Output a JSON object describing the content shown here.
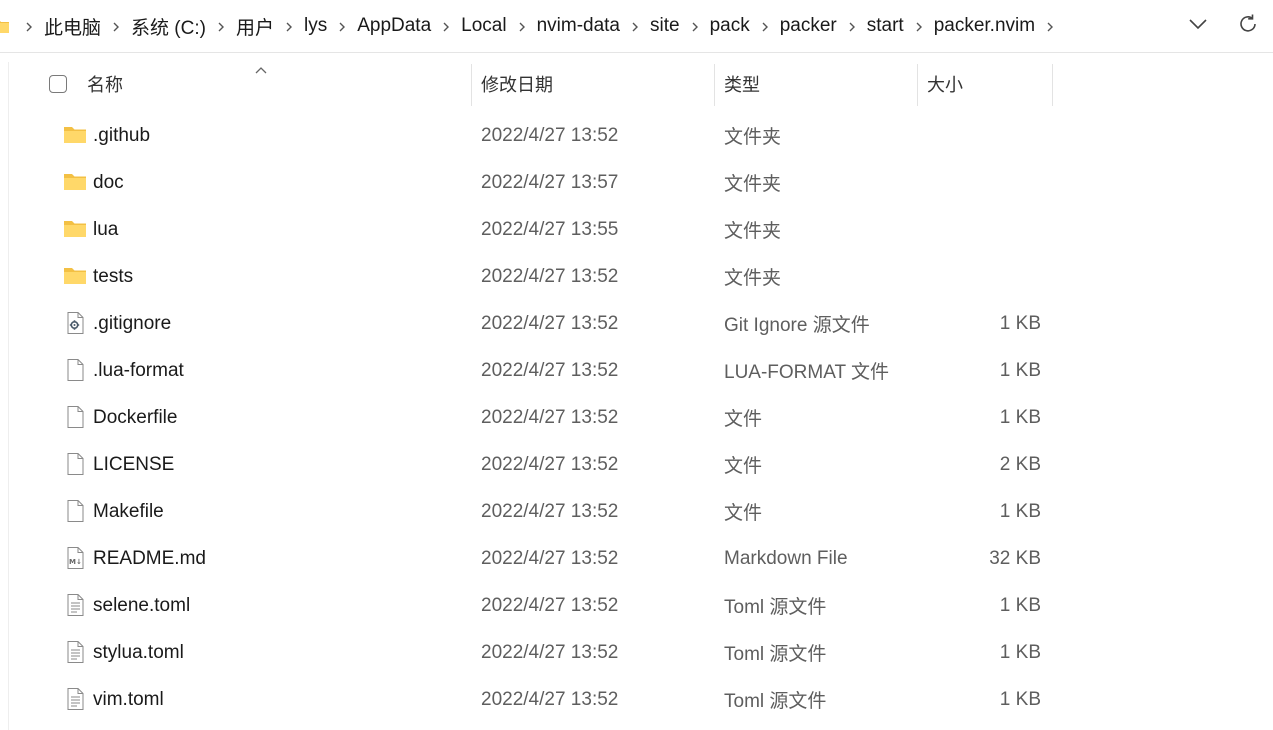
{
  "breadcrumb": {
    "items": [
      "此电脑",
      "系统 (C:)",
      "用户",
      "lys",
      "AppData",
      "Local",
      "nvim-data",
      "site",
      "pack",
      "packer",
      "start",
      "packer.nvim"
    ]
  },
  "columns": {
    "name": "名称",
    "date": "修改日期",
    "type": "类型",
    "size": "大小"
  },
  "files": [
    {
      "name": ".github",
      "date": "2022/4/27 13:52",
      "type": "文件夹",
      "size": "",
      "icon": "folder-icon"
    },
    {
      "name": "doc",
      "date": "2022/4/27 13:57",
      "type": "文件夹",
      "size": "",
      "icon": "folder-icon"
    },
    {
      "name": "lua",
      "date": "2022/4/27 13:55",
      "type": "文件夹",
      "size": "",
      "icon": "folder-icon"
    },
    {
      "name": "tests",
      "date": "2022/4/27 13:52",
      "type": "文件夹",
      "size": "",
      "icon": "folder-icon"
    },
    {
      "name": ".gitignore",
      "date": "2022/4/27 13:52",
      "type": "Git Ignore 源文件",
      "size": "1 KB",
      "icon": "settings-file-icon"
    },
    {
      "name": ".lua-format",
      "date": "2022/4/27 13:52",
      "type": "LUA-FORMAT 文件",
      "size": "1 KB",
      "icon": "file-icon"
    },
    {
      "name": "Dockerfile",
      "date": "2022/4/27 13:52",
      "type": "文件",
      "size": "1 KB",
      "icon": "file-icon"
    },
    {
      "name": "LICENSE",
      "date": "2022/4/27 13:52",
      "type": "文件",
      "size": "2 KB",
      "icon": "file-icon"
    },
    {
      "name": "Makefile",
      "date": "2022/4/27 13:52",
      "type": "文件",
      "size": "1 KB",
      "icon": "file-icon"
    },
    {
      "name": "README.md",
      "date": "2022/4/27 13:52",
      "type": "Markdown File",
      "size": "32 KB",
      "icon": "markdown-file-icon"
    },
    {
      "name": "selene.toml",
      "date": "2022/4/27 13:52",
      "type": "Toml 源文件",
      "size": "1 KB",
      "icon": "text-file-icon"
    },
    {
      "name": "stylua.toml",
      "date": "2022/4/27 13:52",
      "type": "Toml 源文件",
      "size": "1 KB",
      "icon": "text-file-icon"
    },
    {
      "name": "vim.toml",
      "date": "2022/4/27 13:52",
      "type": "Toml 源文件",
      "size": "1 KB",
      "icon": "text-file-icon"
    }
  ],
  "colors": {
    "folder": "#f3c044",
    "folder_light": "#ffd869",
    "secondary_text": "#5e5e5e"
  }
}
